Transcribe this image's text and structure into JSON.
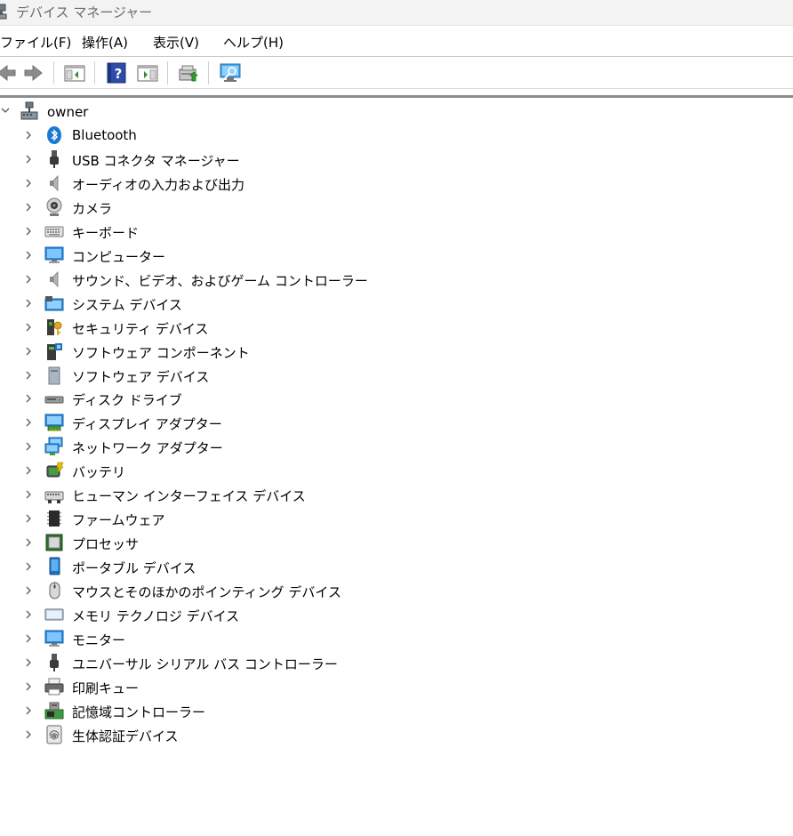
{
  "window": {
    "title": "デバイス マネージャー"
  },
  "menu": {
    "file": "ファイル(F)",
    "action": "操作(A)",
    "view": "表示(V)",
    "help": "ヘルプ(H)"
  },
  "toolbar": {
    "icons": [
      "back-arrow-icon",
      "forward-arrow-icon",
      "show-hide-console-tree-icon",
      "help-icon",
      "show-hide-action-pane-icon",
      "update-driver-icon",
      "scan-hardware-changes-icon"
    ]
  },
  "tree": {
    "root": {
      "label": "owner",
      "icon": "computer-network-icon",
      "expanded": true
    },
    "categories": [
      {
        "label": "Bluetooth",
        "icon": "bluetooth-icon"
      },
      {
        "label": "USB コネクタ マネージャー",
        "icon": "usb-connector-icon"
      },
      {
        "label": "オーディオの入力および出力",
        "icon": "speaker-icon"
      },
      {
        "label": "カメラ",
        "icon": "webcam-icon"
      },
      {
        "label": "キーボード",
        "icon": "keyboard-icon"
      },
      {
        "label": "コンピューター",
        "icon": "monitor-icon"
      },
      {
        "label": "サウンド、ビデオ、およびゲーム コントローラー",
        "icon": "sound-icon"
      },
      {
        "label": "システム デバイス",
        "icon": "system-devices-icon"
      },
      {
        "label": "セキュリティ デバイス",
        "icon": "security-key-icon"
      },
      {
        "label": "ソフトウェア コンポーネント",
        "icon": "software-component-icon"
      },
      {
        "label": "ソフトウェア デバイス",
        "icon": "software-device-icon"
      },
      {
        "label": "ディスク ドライブ",
        "icon": "disk-drive-icon"
      },
      {
        "label": "ディスプレイ アダプター",
        "icon": "display-adapter-icon"
      },
      {
        "label": "ネットワーク アダプター",
        "icon": "network-adapter-icon"
      },
      {
        "label": "バッテリ",
        "icon": "battery-icon"
      },
      {
        "label": "ヒューマン インターフェイス デバイス",
        "icon": "hid-icon"
      },
      {
        "label": "ファームウェア",
        "icon": "firmware-icon"
      },
      {
        "label": "プロセッサ",
        "icon": "processor-icon"
      },
      {
        "label": "ポータブル デバイス",
        "icon": "portable-device-icon"
      },
      {
        "label": "マウスとそのほかのポインティング デバイス",
        "icon": "mouse-icon"
      },
      {
        "label": "メモリ テクノロジ デバイス",
        "icon": "memory-technology-icon"
      },
      {
        "label": "モニター",
        "icon": "monitor-icon"
      },
      {
        "label": "ユニバーサル シリアル バス コントローラー",
        "icon": "usb-controller-icon"
      },
      {
        "label": "印刷キュー",
        "icon": "printer-icon"
      },
      {
        "label": "記憶域コントローラー",
        "icon": "storage-controller-icon"
      },
      {
        "label": "生体認証デバイス",
        "icon": "fingerprint-icon"
      }
    ]
  },
  "colors": {
    "titlebar": "#f3f3f3",
    "accent": "#0078d7",
    "chevron": "#5a5a5a"
  }
}
